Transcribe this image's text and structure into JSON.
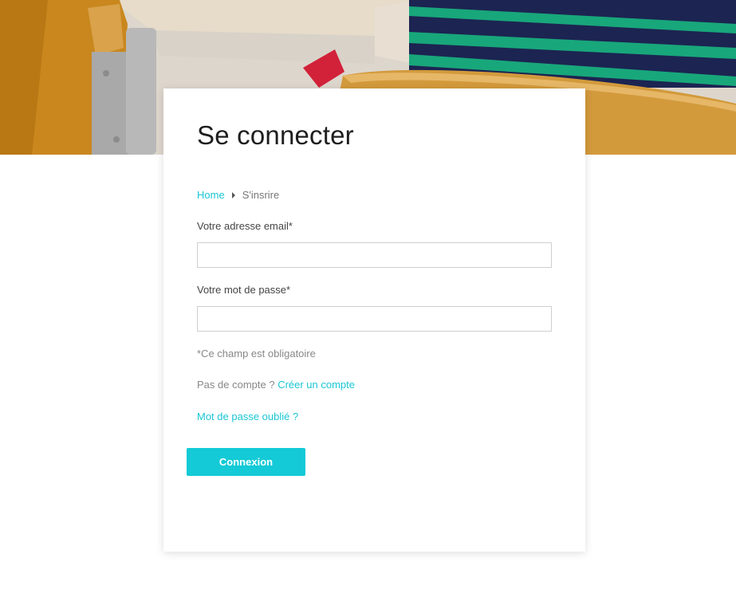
{
  "page": {
    "title": "Se connecter"
  },
  "breadcrumb": {
    "home": "Home",
    "current": "S'insrire"
  },
  "form": {
    "email_label": "Votre adresse email*",
    "email_value": "",
    "password_label": "Votre mot de passe*",
    "password_value": "",
    "required_note": "*Ce champ est obligatoire",
    "no_account_text": "Pas de compte ?",
    "create_account_link": "Créer un compte",
    "forgot_password_link": "Mot de passe oublié ?",
    "submit_label": "Connexion"
  },
  "colors": {
    "accent": "#13cad6",
    "link": "#1ac6d4"
  }
}
